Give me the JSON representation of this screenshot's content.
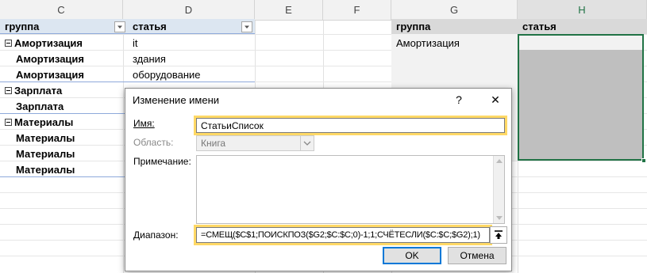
{
  "columns": {
    "c": "C",
    "d": "D",
    "e": "E",
    "f": "F",
    "g": "G",
    "h": "H"
  },
  "pivot": {
    "header_group": "группа",
    "header_article": "статья",
    "rows": [
      {
        "group": "Амортизация",
        "article": "it",
        "expander": true
      },
      {
        "group": "Амортизация",
        "article": "здания",
        "expander": false
      },
      {
        "group": "Амортизация",
        "article": "оборудование",
        "expander": false
      },
      {
        "group": "Зарплата",
        "article": "",
        "expander": true
      },
      {
        "group": "Зарплата",
        "article": "",
        "expander": false
      },
      {
        "group": "Материалы",
        "article": "",
        "expander": true
      },
      {
        "group": "Материалы",
        "article": "",
        "expander": false
      },
      {
        "group": "Материалы",
        "article": "",
        "expander": false
      },
      {
        "group": "Материалы",
        "article": "",
        "expander": false
      }
    ]
  },
  "right_table": {
    "header_group": "группа",
    "header_article": "статья",
    "g_value": "Амортизация"
  },
  "dialog": {
    "title": "Изменение имени",
    "help": "?",
    "close": "✕",
    "name_label": "Имя:",
    "name_value": "СтатьиСписок",
    "scope_label": "Область:",
    "scope_value": "Книга",
    "comment_label": "Примечание:",
    "comment_value": "",
    "range_label": "Диапазон:",
    "range_value": "=СМЕЩ($C$1;ПОИСКПОЗ($G2;$C:$C;0)-1;1;СЧЁТЕСЛИ($C:$C;$G2);1)",
    "ok_label": "OK",
    "cancel_label": "Отмена"
  },
  "colors": {
    "accent_green": "#217346",
    "highlight_yellow": "#ffd966",
    "pivot_blue": "#dce6f1",
    "selection_grey": "#bfbfbf"
  }
}
